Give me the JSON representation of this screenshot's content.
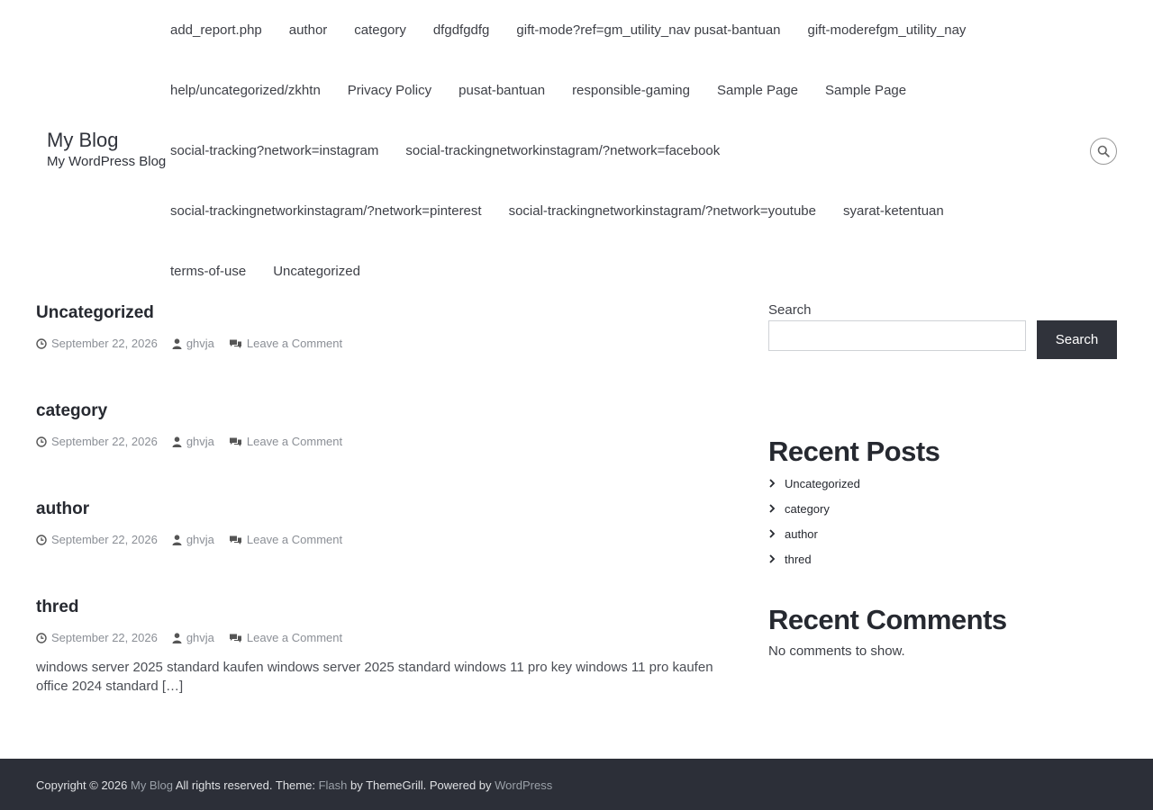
{
  "header": {
    "site_title": "My Blog",
    "site_description": "My WordPress Blog",
    "nav_rows": [
      [
        "add_report.php",
        "author",
        "category",
        "dfgdfgdfg",
        "gift-mode?ref=gm_utility_nav pusat-bantuan",
        "gift-moderefgm_utility_nay"
      ],
      [
        "help/uncategorized/zkhtn",
        "Privacy Policy",
        "pusat-bantuan",
        "responsible-gaming",
        "Sample Page",
        "Sample Page"
      ],
      [
        "social-tracking?network=instagram",
        "social-trackingnetworkinstagram/?network=facebook"
      ],
      [
        "social-trackingnetworkinstagram/?network=pinterest",
        "social-trackingnetworkinstagram/?network=youtube",
        "syarat-ketentuan"
      ],
      [
        "terms-of-use",
        "Uncategorized"
      ]
    ],
    "search_icon": "search-icon"
  },
  "posts": [
    {
      "title": "Uncategorized",
      "date": "September 22, 2026",
      "author": "ghvja",
      "comments": "Leave a Comment",
      "excerpt": ""
    },
    {
      "title": "category",
      "date": "September 22, 2026",
      "author": "ghvja",
      "comments": "Leave a Comment",
      "excerpt": ""
    },
    {
      "title": "author",
      "date": "September 22, 2026",
      "author": "ghvja",
      "comments": "Leave a Comment",
      "excerpt": ""
    },
    {
      "title": "thred",
      "date": "September 22, 2026",
      "author": "ghvja",
      "comments": "Leave a Comment",
      "excerpt": "windows server 2025 standard kaufen windows server 2025 standard windows 11 pro key windows 11 pro kaufen office 2024 standard […]"
    }
  ],
  "sidebar": {
    "search_label": "Search",
    "search_value": "",
    "search_button": "Search",
    "recent_posts_title": "Recent Posts",
    "recent_posts": [
      "Uncategorized",
      "category",
      "author",
      "thred"
    ],
    "recent_comments_title": "Recent Comments",
    "no_comments": "No comments to show."
  },
  "footer": {
    "copyright": "Copyright © 2026 ",
    "site_link": "My Blog",
    "rights": " All rights reserved. Theme: ",
    "theme_link": "Flash",
    "by": " by ThemeGrill. Powered by ",
    "wp_link": "WordPress"
  },
  "colors": {
    "footer_bg": "#2c2f38",
    "button_bg": "#30333b",
    "meta_text": "#8b8f96"
  }
}
